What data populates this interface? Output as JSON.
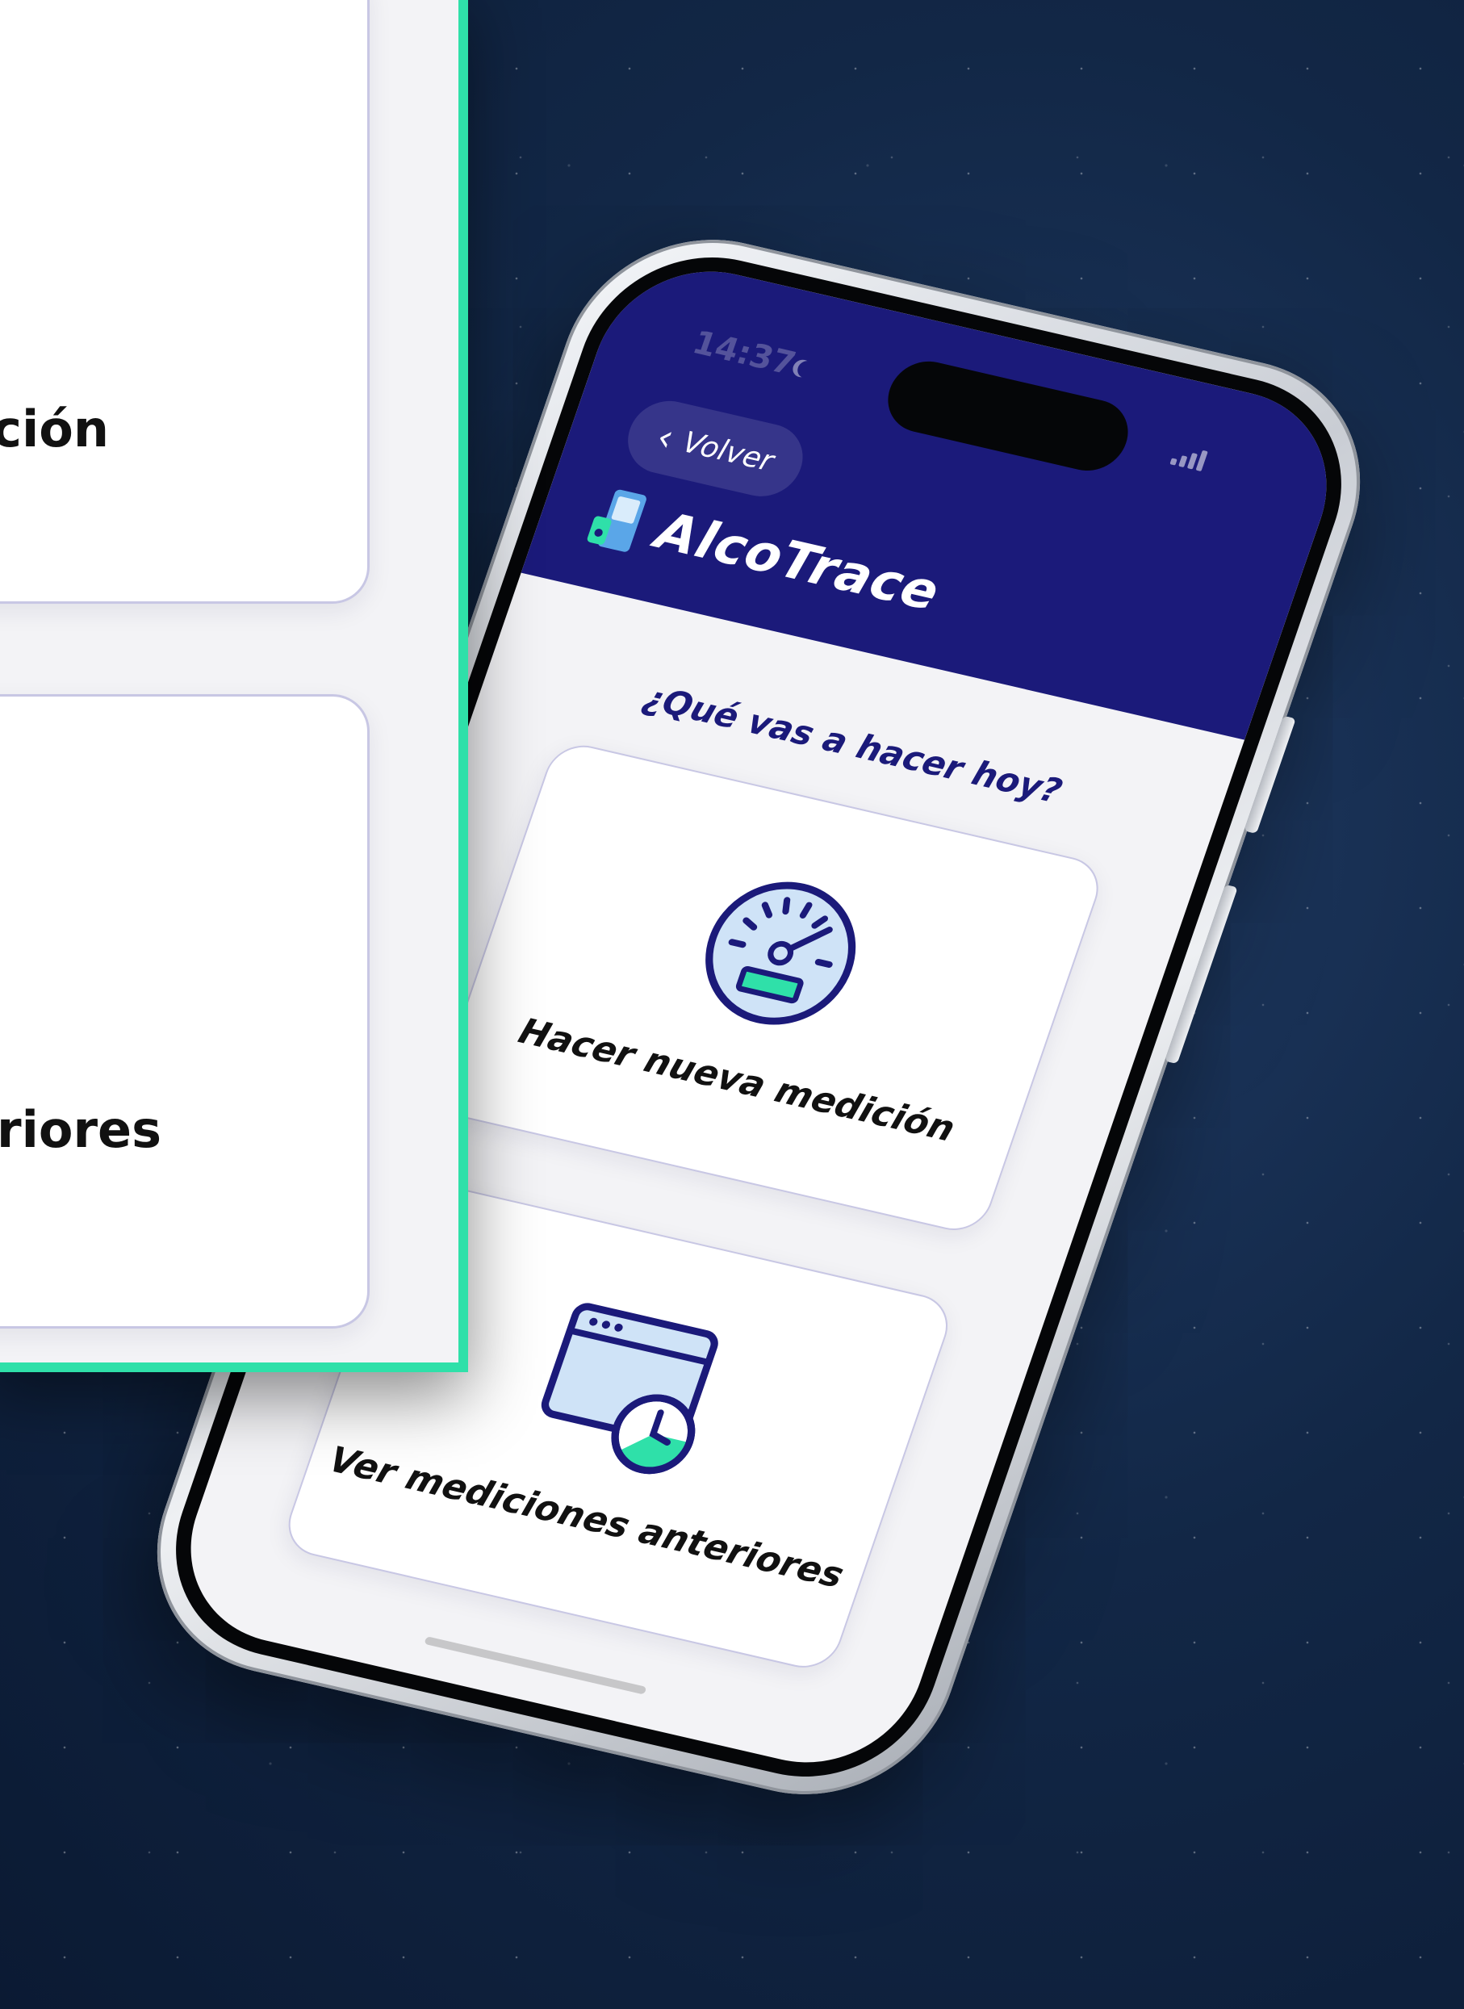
{
  "status_bar": {
    "time": "14:37"
  },
  "header": {
    "back_label": "Volver",
    "app_title": "AlcoTrace"
  },
  "main": {
    "question": "¿Qué vas a hacer hoy?",
    "options": [
      {
        "label": "Hacer nueva medición",
        "icon": "speedometer-icon"
      },
      {
        "label": "Ver mediciones anteriores",
        "icon": "history-window-clock-icon"
      }
    ]
  },
  "zoom": {
    "label_1_tail": "ción",
    "label_2_tail": "eriores"
  },
  "colors": {
    "header_bg": "#1b1a7a",
    "accent_green": "#2fe0a9",
    "icon_fill": "#cfe3f7",
    "card_border": "#c8c7e4"
  }
}
